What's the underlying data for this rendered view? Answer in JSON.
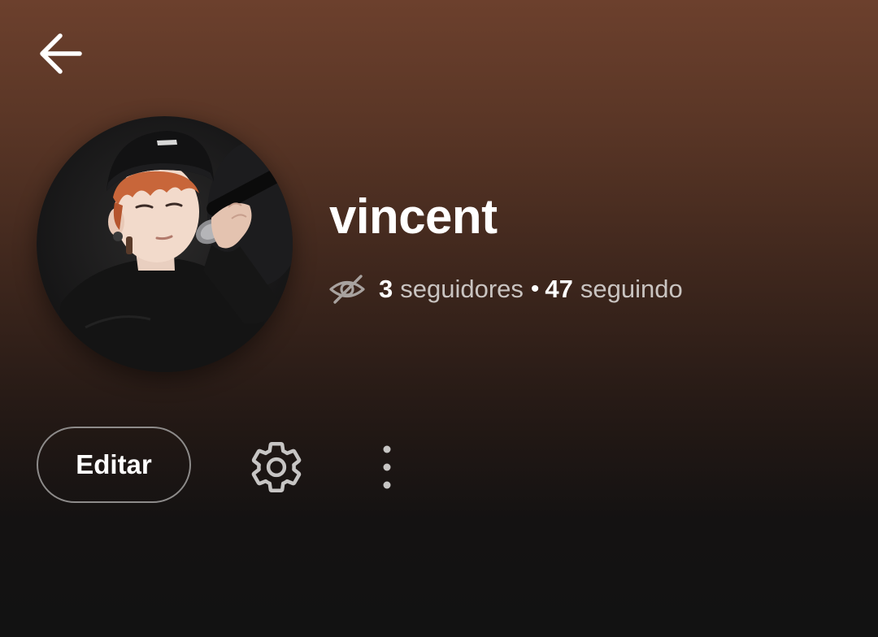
{
  "header": {
    "back_icon": "arrow-left-icon"
  },
  "profile": {
    "name": "vincent",
    "avatar_icon": "profile-photo",
    "privacy_icon": "eye-off-icon",
    "followers_count": "3",
    "followers_label": "seguidores",
    "separator": "•",
    "following_count": "47",
    "following_label": "seguindo"
  },
  "actions": {
    "edit_label": "Editar",
    "settings_icon": "gear-icon",
    "more_icon": "more-vertical-icon"
  },
  "colors": {
    "gradient_top": "#6c402d",
    "background": "#121212",
    "text_primary": "#ffffff",
    "text_secondary": "#c9c4c1",
    "button_border": "#8d8b8a"
  }
}
